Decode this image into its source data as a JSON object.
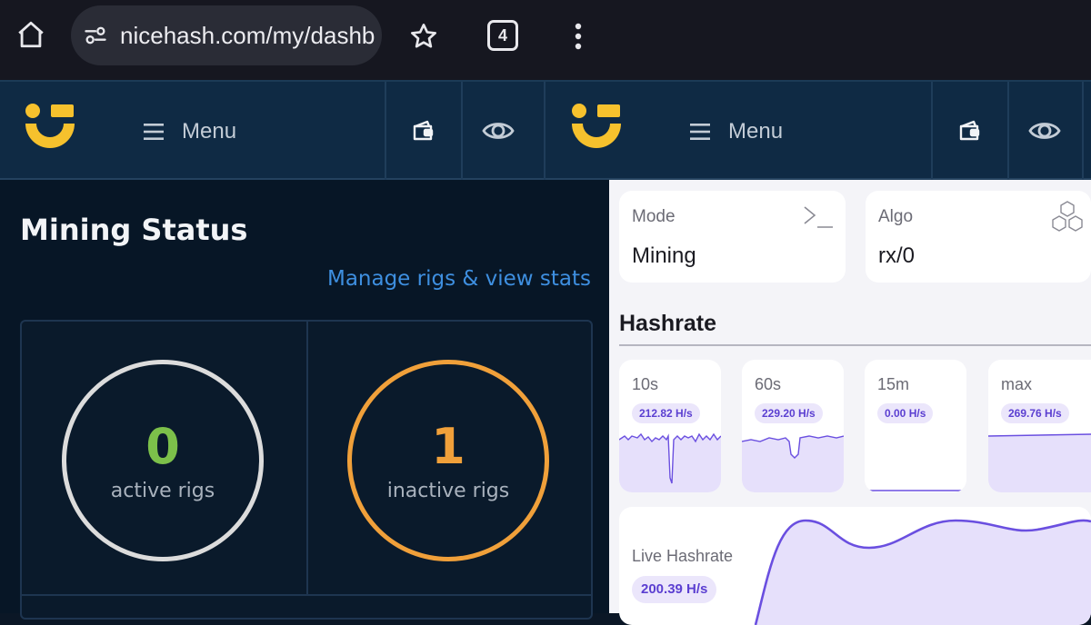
{
  "browser": {
    "url": "nicehash.com/my/dashboard",
    "tab_count": "4",
    "icons": [
      "home-icon",
      "site-settings-icon",
      "star-icon",
      "tabs-icon",
      "more-vert-icon"
    ]
  },
  "header": {
    "menu_label": "Menu",
    "menu_label_2": "Menu",
    "icons": [
      "nicehash-logo",
      "hamburger-icon",
      "wallet-icon",
      "eye-icon"
    ]
  },
  "mining_status": {
    "title": "Mining Status",
    "manage_link": "Manage rigs & view stats",
    "active": {
      "count": "0",
      "label": "active rigs",
      "color": "#7cc04a"
    },
    "inactive": {
      "count": "1",
      "label": "inactive rigs",
      "color": "#f0a03a"
    }
  },
  "miner": {
    "mode_label": "Mode",
    "mode_value": "Mining",
    "algo_label": "Algo",
    "algo_value": "rx/0",
    "hashrate_title": "Hashrate",
    "windows": [
      {
        "label": "10s",
        "value": "212.82 H/s"
      },
      {
        "label": "60s",
        "value": "229.20 H/s"
      },
      {
        "label": "15m",
        "value": "0.00 H/s"
      },
      {
        "label": "max",
        "value": "269.76 H/s"
      }
    ],
    "live_label": "Live Hashrate",
    "live_value": "200.39 H/s"
  },
  "colors": {
    "accent_purple": "#6a4fe0",
    "link_blue": "#3e8fe0",
    "logo_yellow": "#f6c12d"
  }
}
